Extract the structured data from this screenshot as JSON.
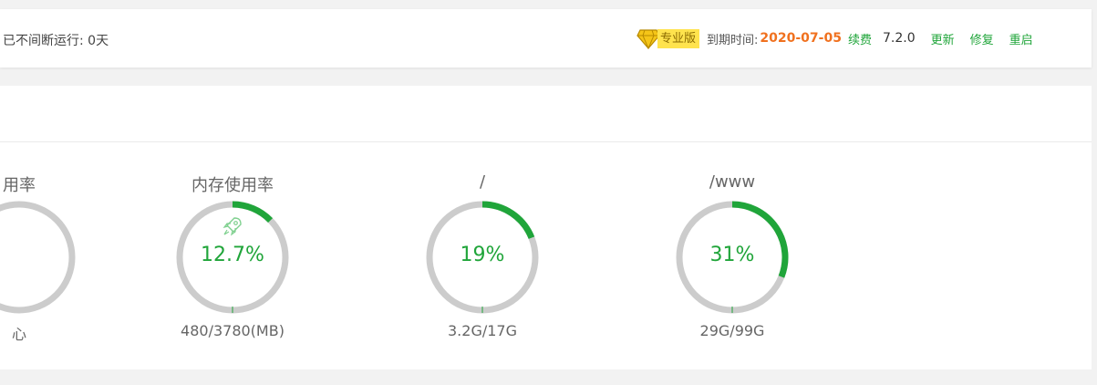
{
  "header": {
    "uptime_text": "已不间断运行: 0天",
    "pro_label": "专业版",
    "expire_label": "到期时间:",
    "expire_date": "2020-07-05",
    "renew_label": "续费",
    "version": "7.2.0",
    "update_label": "更新",
    "repair_label": "修复",
    "restart_label": "重启"
  },
  "gauges": [
    {
      "title": "用率",
      "percent_text": "",
      "percent": 0,
      "detail": "心"
    },
    {
      "title": "内存使用率",
      "percent_text": "12.7%",
      "percent": 12.7,
      "detail": "480/3780(MB)",
      "icon": "rocket-icon"
    },
    {
      "title": "/",
      "percent_text": "19%",
      "percent": 19,
      "detail": "3.2G/17G"
    },
    {
      "title": "/www",
      "percent_text": "31%",
      "percent": 31,
      "detail": "29G/99G"
    }
  ],
  "colors": {
    "accent": "#20a53a",
    "ring_bg": "#cccccc",
    "expire": "#f0711f",
    "badge": "#ffe34d"
  }
}
